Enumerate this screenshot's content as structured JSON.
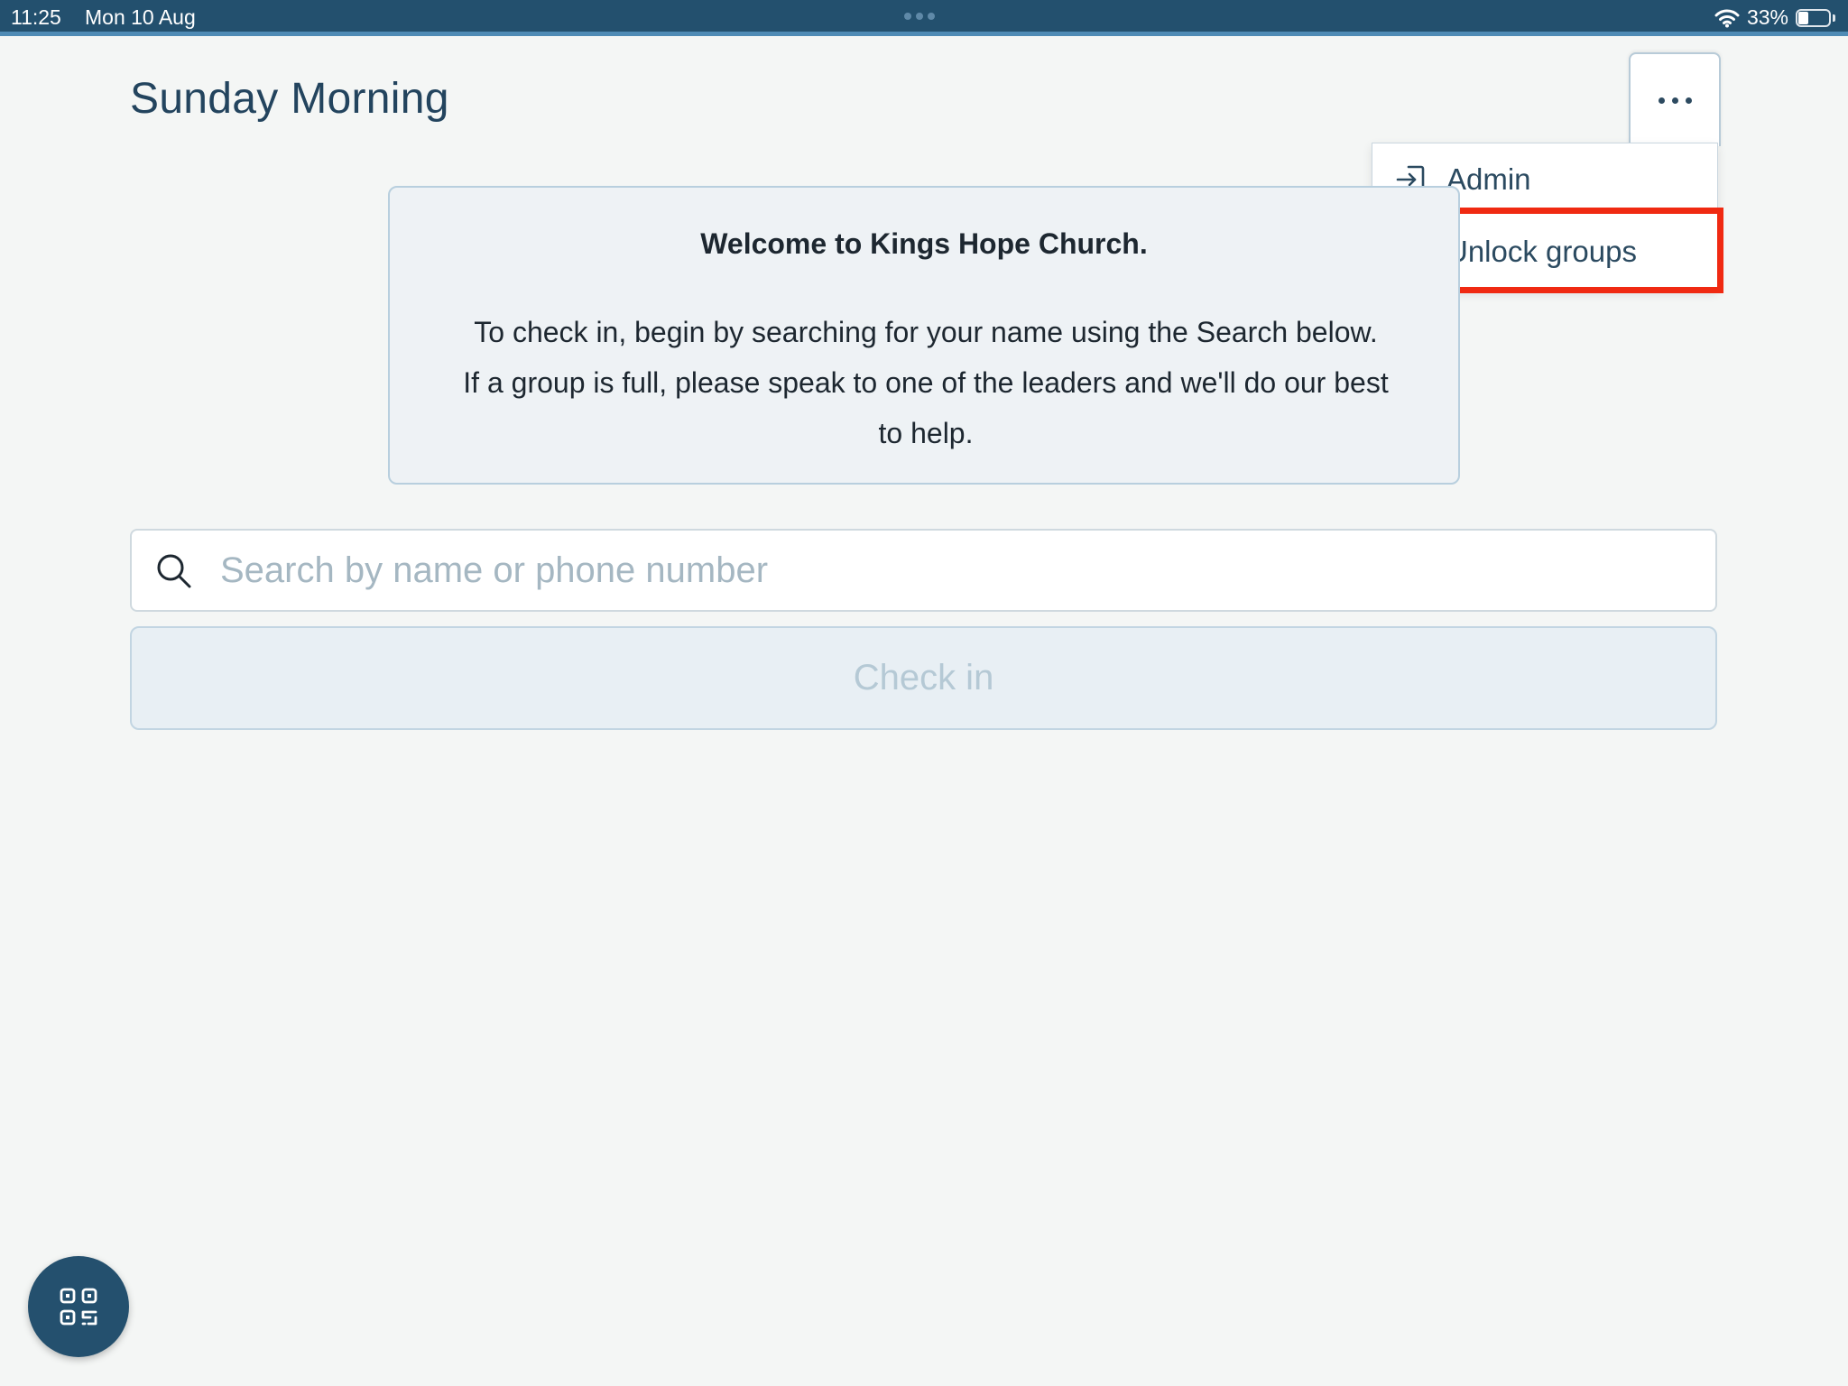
{
  "status_bar": {
    "time": "11:25",
    "date": "Mon 10 Aug",
    "battery": "33%",
    "battery_level": 0.33
  },
  "header": {
    "title": "Sunday Morning",
    "more_icon": "more-horizontal-icon"
  },
  "menu": {
    "items": [
      {
        "label": "Admin",
        "icon": "sign-in-icon"
      },
      {
        "label": "Unlock groups",
        "icon": "users-group-icon"
      }
    ],
    "highlight_color": "#f02a12"
  },
  "welcome": {
    "title": "Welcome to Kings Hope Church.",
    "lines": [
      "To check in, begin by searching for your name using the Search below.",
      "If a group is full, please speak to one of the leaders and we'll do our best",
      "to help."
    ]
  },
  "search": {
    "placeholder": "Search by name or phone number",
    "value": ""
  },
  "checkin": {
    "label": "Check in"
  },
  "qr_button": {
    "icon": "qr-scan-icon"
  },
  "colors": {
    "primary": "#24506e",
    "title": "#23445e",
    "background": "#f4f6f5",
    "card": "#eef2f5",
    "highlight": "#f02a12"
  }
}
